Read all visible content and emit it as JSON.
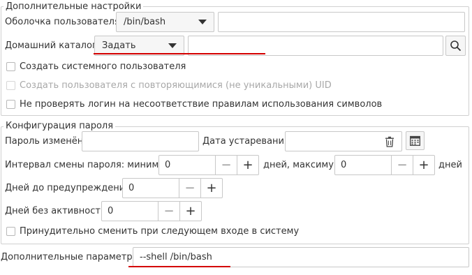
{
  "advanced": {
    "legend": "Дополнительные настройки",
    "shell_label": "Оболочка пользователя:",
    "shell_value": "/bin/bash",
    "home_label": "Домашний каталог:",
    "home_mode": "Задать",
    "home_value": "",
    "create_system_user": "Создать системного пользователя",
    "create_duplicate_uid": "Создать пользователя с повторяющимися (не уникальными) UID",
    "skip_login_check": "Не проверять логин на несоответствие правилам использования символов"
  },
  "password": {
    "legend": "Конфигурация пароля",
    "changed_label": "Пароль изменён:",
    "changed_value": "",
    "expire_label": "Дата устаревания:",
    "expire_value": "",
    "interval_min_label": "Интервал смены пароля: минимум",
    "interval_min_value": "0",
    "interval_max_label": "дней, максимум",
    "interval_max_value": "0",
    "days_unit": "дней",
    "warn_label": "Дней до предупреждения:",
    "warn_value": "0",
    "inactive_label": "Дней без активности:",
    "inactive_value": "0",
    "force_change": "Принудительно сменить при следующем входе в систему",
    "minus_symbol": "−",
    "plus_symbol": "+"
  },
  "extra": {
    "label": "Дополнительные параметры:",
    "value": "--shell /bin/bash"
  },
  "icons": {
    "search": "search-icon",
    "trash": "trash-icon",
    "calendar": "calendar-icon",
    "dropdown": "chevron-down-icon"
  },
  "colors": {
    "annotation_underline": "#d40000",
    "border": "#c8c8c8"
  }
}
